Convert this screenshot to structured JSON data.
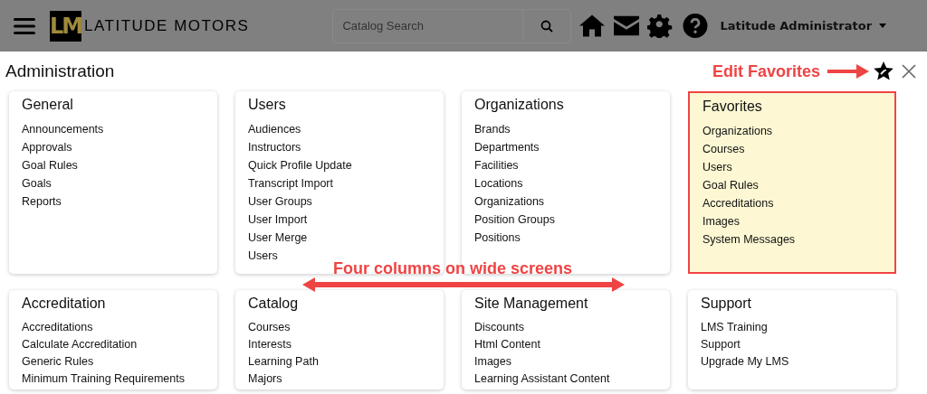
{
  "header": {
    "logo_mark": "LM",
    "brand": "LATITUDE MOTORS",
    "search": {
      "placeholder": "Catalog Search"
    },
    "user": "Latitude Administrator"
  },
  "page": {
    "title": "Administration"
  },
  "annotations": [
    {
      "kind": "arrow-right",
      "text": "Edit Favorites"
    },
    {
      "kind": "double-arrow",
      "text": "Four columns on wide screens"
    }
  ],
  "cards": [
    {
      "title": "General",
      "highlighted": false,
      "items": [
        "Announcements",
        "Approvals",
        "Goal Rules",
        "Goals",
        "Reports"
      ]
    },
    {
      "title": "Users",
      "highlighted": false,
      "items": [
        "Audiences",
        "Instructors",
        "Quick Profile Update",
        "Transcript Import",
        "User Groups",
        "User Import",
        "User Merge",
        "Users"
      ]
    },
    {
      "title": "Organizations",
      "highlighted": false,
      "items": [
        "Brands",
        "Departments",
        "Facilities",
        "Locations",
        "Organizations",
        "Position Groups",
        "Positions"
      ]
    },
    {
      "title": "Favorites",
      "highlighted": true,
      "items": [
        "Organizations",
        "Courses",
        "Users",
        "Goal Rules",
        "Accreditations",
        "Images",
        "System Messages"
      ]
    },
    {
      "title": "Accreditation",
      "highlighted": false,
      "items": [
        "Accreditations",
        "Calculate Accreditation",
        "Generic Rules",
        "Minimum Training Requirements"
      ]
    },
    {
      "title": "Catalog",
      "highlighted": false,
      "items": [
        "Courses",
        "Interests",
        "Learning Path",
        "Majors"
      ]
    },
    {
      "title": "Site Management",
      "highlighted": false,
      "items": [
        "Discounts",
        "Html Content",
        "Images",
        "Learning Assistant Content"
      ]
    },
    {
      "title": "Support",
      "highlighted": false,
      "items": [
        "LMS Training",
        "Support",
        "Upgrade My LMS"
      ]
    }
  ]
}
